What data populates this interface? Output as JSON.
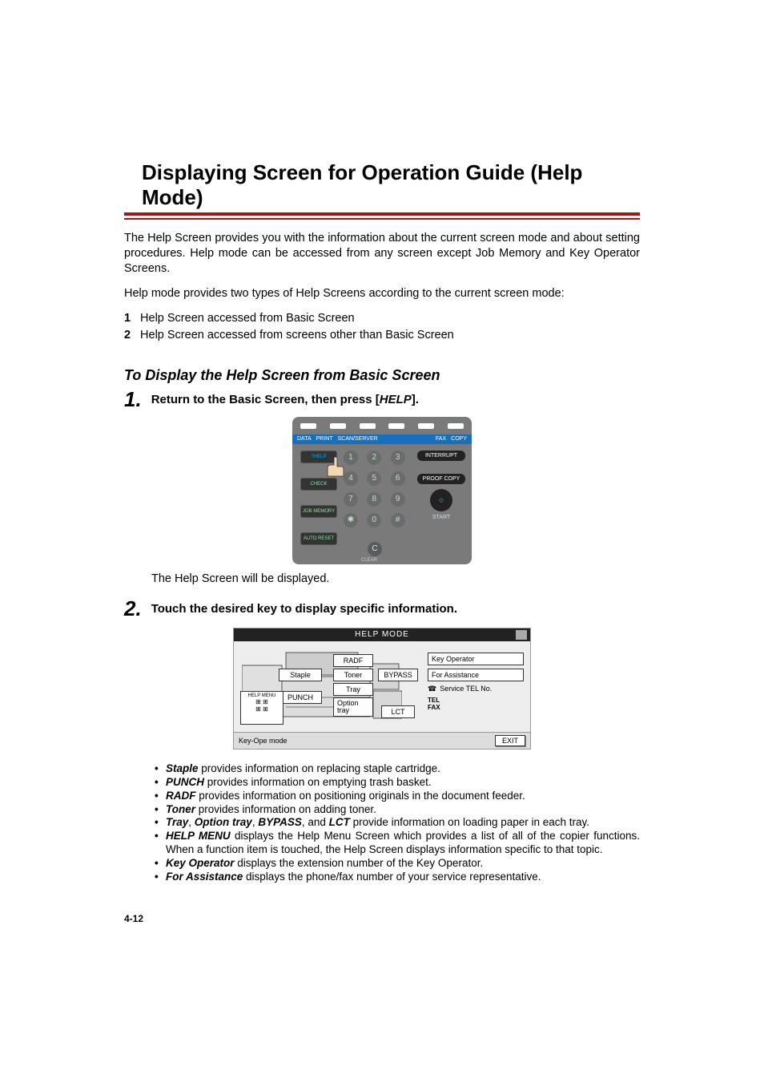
{
  "title": "Displaying Screen for Operation Guide (Help Mode)",
  "intro_para": "The Help Screen provides you with the information about the current screen mode and about setting procedures. Help mode can be accessed from any screen except Job Memory and Key Operator Screens.",
  "modes_intro": "Help mode provides two types of Help Screens according to the current screen mode:",
  "mode_items": {
    "n1": "1",
    "t1": "Help Screen accessed from Basic Screen",
    "n2": "2",
    "t2": "Help Screen accessed from screens other than Basic Screen"
  },
  "subhead": "To Display the Help Screen from Basic Screen",
  "step1": {
    "num": "1.",
    "pre": "Return to the Basic Screen, then press [",
    "key": "HELP",
    "post": "]."
  },
  "panel1": {
    "bar": {
      "data": "DATA",
      "print": "PRINT",
      "scan": "SCAN/SERVER",
      "fax": "FAX",
      "copy": "COPY"
    },
    "left": {
      "help": "HELP",
      "check": "CHECK",
      "jobmem": "JOB MEMORY",
      "autoreset": "AUTO RESET"
    },
    "right": {
      "interrupt": "INTERRUPT",
      "proof": "PROOF COPY",
      "start": "START"
    },
    "keys": {
      "k1": "1",
      "k2": "2",
      "k3": "3",
      "k4": "4",
      "k5": "5",
      "k6": "6",
      "k7": "7",
      "k8": "8",
      "k9": "9",
      "ks": "✱",
      "k0": "0",
      "kh": "#",
      "clear": "C",
      "clear_lbl": "CLEAR"
    }
  },
  "after_panel1": "The Help Screen will be displayed.",
  "step2": {
    "num": "2.",
    "text": "Touch the desired key to display specific information."
  },
  "panel2": {
    "title": "HELP MODE",
    "staple": "Staple",
    "punch": "PUNCH",
    "radf": "RADF",
    "toner": "Toner",
    "tray": "Tray",
    "optiontray": "Option tray",
    "bypass": "BYPASS",
    "lct": "LCT",
    "helpmenu": "HELP MENU",
    "keyop": "Key Operator",
    "assist": "For Assistance",
    "svc": "Service TEL No.",
    "tel": "TEL",
    "fax": "FAX",
    "footer": "Key-Ope mode",
    "exit": "EXIT"
  },
  "bullets": {
    "b1a": "Staple",
    "b1b": " provides information on replacing staple cartridge.",
    "b2a": "PUNCH",
    "b2b": " provides information on emptying trash basket.",
    "b3a": "RADF",
    "b3b": " provides information on positioning originals in the document feeder.",
    "b4a": "Toner",
    "b4b": " provides information on adding toner.",
    "b5a": "Tray",
    "b5b": "Option tray",
    "b5c": "BYPASS",
    "b5d": "LCT",
    "b5txt1": ", ",
    "b5txt2": ", ",
    "b5txt3": ", and ",
    "b5txt4": " provide information on loading paper in each tray.",
    "b6a": "HELP MENU",
    "b6b": " displays the Help Menu Screen which provides a list of all of the copier functions. When a function item is touched, the Help Screen displays information specific to that topic.",
    "b7a": "Key Operator",
    "b7b": " displays the extension number of the Key Operator.",
    "b8a": "For Assistance",
    "b8b": " displays the phone/fax number of your service representative."
  },
  "pagenum": "4-12"
}
